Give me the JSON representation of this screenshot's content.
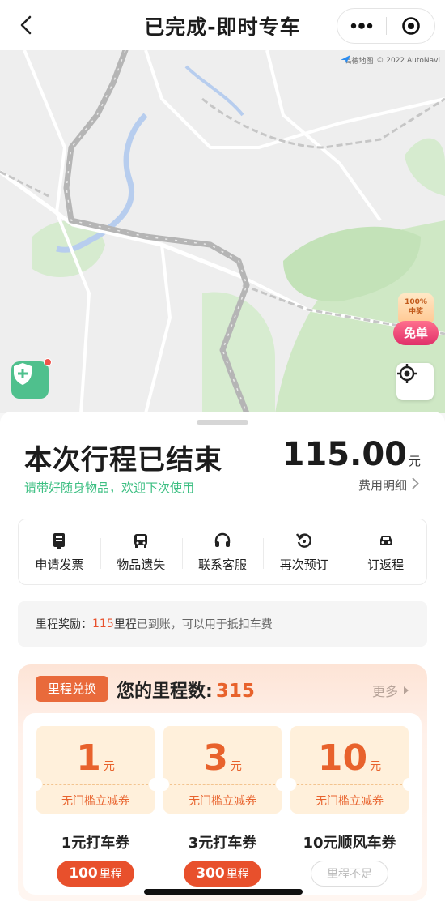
{
  "nav": {
    "title": "已完成-即时专车"
  },
  "map": {
    "credit": "© 2022 AutoNavi",
    "brand": "高德地图"
  },
  "badge": {
    "top1": "100%",
    "top2": "中奖",
    "label": "免单"
  },
  "trip": {
    "title": "本次行程已结束",
    "subtitle": "请带好随身物品，欢迎下次使用",
    "price": "115.00",
    "price_unit": "元",
    "detail_label": "费用明细"
  },
  "actions": [
    {
      "label": "申请发票",
      "icon": "invoice-icon"
    },
    {
      "label": "物品遗失",
      "icon": "lost-item-icon"
    },
    {
      "label": "联系客服",
      "icon": "headset-icon"
    },
    {
      "label": "再次预订",
      "icon": "rebook-icon"
    },
    {
      "label": "订返程",
      "icon": "car-icon"
    }
  ],
  "reward": {
    "label": "里程奖励：",
    "amount": "115",
    "unit": "里程",
    "text": "已到账，可以用于抵扣车费"
  },
  "exchange": {
    "tag": "里程兑换",
    "label": "您的里程数:",
    "count": "315",
    "more": "更多",
    "coupons": [
      {
        "amount": "1",
        "unit": "元",
        "desc": "无门槛立减券",
        "name": "1元打车券",
        "cost": "100",
        "cost_unit": "里程"
      },
      {
        "amount": "3",
        "unit": "元",
        "desc": "无门槛立减券",
        "name": "3元打车券",
        "cost": "300",
        "cost_unit": "里程"
      },
      {
        "amount": "10",
        "unit": "元",
        "desc": "无门槛立减券",
        "name": "10元顺风车券",
        "status": "里程不足"
      }
    ]
  },
  "colors": {
    "accent": "#e8502c",
    "green": "#3cbf82",
    "shield": "#4fc08d"
  }
}
